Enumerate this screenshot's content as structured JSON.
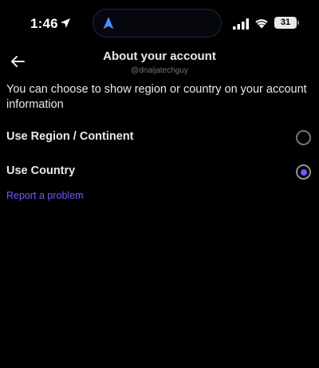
{
  "status_bar": {
    "time": "1:46",
    "battery": "31",
    "icons": [
      "location-arrow-icon",
      "navigation-icon",
      "signal-icon",
      "wifi-icon",
      "battery-icon"
    ]
  },
  "header": {
    "back_icon": "arrow-left-icon",
    "title": "About your account",
    "subtitle": "@dnaijatechguy"
  },
  "main": {
    "description": "You can choose to show region or country on your account information",
    "options": [
      {
        "label": "Use Region / Continent",
        "selected": false
      },
      {
        "label": "Use Country",
        "selected": true
      }
    ],
    "report_link": "Report a problem"
  },
  "colors": {
    "background": "#000000",
    "accent": "#7856ff",
    "text": "#e7e9ea",
    "muted": "#71767b"
  }
}
